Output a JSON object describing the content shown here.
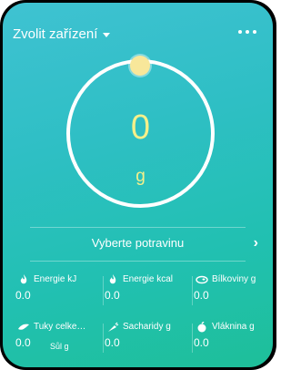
{
  "header": {
    "device_select": "Zvolit zařízení"
  },
  "scale": {
    "weight": "0",
    "unit": "g"
  },
  "food": {
    "select_label": "Vyberte potravinu"
  },
  "nutrients": [
    [
      {
        "label": "Energie kJ",
        "value": "0.0",
        "icon": "flame-icon"
      },
      {
        "label": "Energie kcal",
        "value": "0.0",
        "icon": "flame-icon"
      },
      {
        "label": "Bílkoviny g",
        "value": "0.0",
        "icon": "steak-icon"
      }
    ],
    [
      {
        "label": "Tuky celke…",
        "value": "0.0",
        "icon": "fish-icon"
      },
      {
        "label": "Sacharidy g",
        "value": "0.0",
        "icon": "carrot-icon"
      },
      {
        "label": "Vláknina g",
        "value": "0.0",
        "icon": "apple-icon"
      }
    ]
  ],
  "partial_label": "Sůl g"
}
